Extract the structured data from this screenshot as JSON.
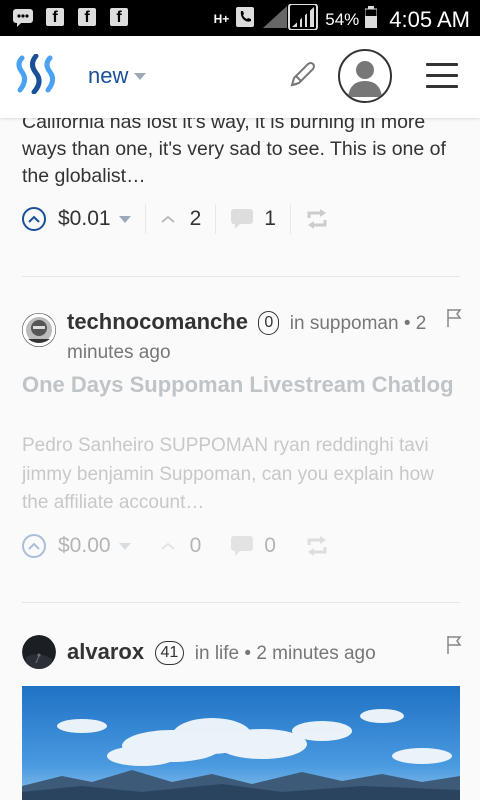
{
  "status_bar": {
    "network": "H+",
    "battery": "54%",
    "time": "4:05 AM"
  },
  "header": {
    "nav_label": "new",
    "icons": [
      "steemit-logo",
      "pencil-icon",
      "avatar-icon",
      "menu-icon"
    ]
  },
  "feed": {
    "post0": {
      "excerpt": "California has lost it's way, it is burning in more ways than one, it's very sad to see. This is one of the globalist…",
      "payout": "$0.01",
      "votes": "2",
      "comments": "1"
    },
    "post1": {
      "author": "technocomanche",
      "reputation": "0",
      "meta_first": "in suppoman • 2",
      "meta_second": "minutes ago",
      "title": "One Days Suppoman Livestream Chatlog",
      "body": "Pedro Sanheiro SUPPOMAN ryan reddinghi tavi jimmy benjamin Suppoman, can you explain how the affiliate account…",
      "payout": "$0.00",
      "votes": "0",
      "comments": "0"
    },
    "post2": {
      "author": "alvarox",
      "reputation": "41",
      "meta": "in life • 2 minutes ago"
    }
  },
  "colors": {
    "brand_blue": "#1a5099",
    "text_dark": "#333333",
    "muted": "#777777"
  }
}
